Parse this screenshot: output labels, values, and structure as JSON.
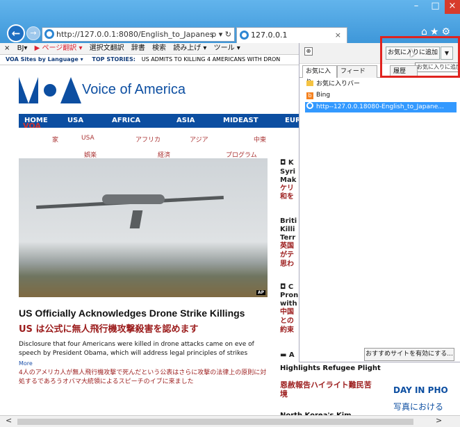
{
  "browser": {
    "address": "http://127.0.0.1:8080/English_to_Japanes",
    "address_host": "127.0.0.1",
    "address_controls": "ρ ▾ ↻",
    "tab_title": "127.0.0.1",
    "tab_close": "×",
    "back_icon": "←",
    "forward_icon": "→",
    "window_minimize": "–",
    "window_maximize": "□",
    "window_close": "×",
    "top_icons": "⌂★⚙"
  },
  "command_bar": {
    "items": [
      "×",
      "BJ▾",
      "▶ ページ翻訳 ▾",
      "選択文翻訳",
      "辞書",
      "検索",
      "読み上げ ▾",
      "ツール ▾"
    ]
  },
  "voa_bar": {
    "brand": "VOA",
    "sites": "Sites by Language ▾",
    "top_label": "TOP STORIES:",
    "headline": "US ADMITS TO KILLING 4 AMERICANS WITH DRON"
  },
  "site": {
    "name": "Voice of America",
    "nav": [
      "HOME",
      "USA",
      "AFRICA",
      "ASIA",
      "MIDEAST",
      "EUR"
    ],
    "nav_overlay": "VOA",
    "subnav_row1": [
      "家",
      "USA",
      "アフリカ",
      "アジア",
      "中東"
    ],
    "subnav_row2": [
      "娯楽",
      "経済",
      "プログラム"
    ]
  },
  "article": {
    "photo_credit": "AP",
    "headline": "US Officially Acknowledges Drone Strike Killings",
    "headline_ja": "US は公式に無人飛行機攻撃殺害を認めます",
    "summary": "Disclosure that four Americans were killed in drone attacks came on eve of speech by President Obama, which will address legal principles of strikes",
    "more": "More",
    "summary_ja": "4人のアメリカ人が無人飛行機攻撃で死んだという公表はさらに攻撃の法律上の原則に対処するであろうオバマ大統領によるスピーチのイブに来ました"
  },
  "sidebar_stories": {
    "s1": [
      "◘ K",
      "Syri",
      "Mak",
      "ケリ",
      "和を"
    ],
    "s2": [
      "Briti",
      "Killi",
      "Terr",
      "英国",
      "がテ",
      "思わ"
    ],
    "s3": [
      "◘ C",
      "Pron",
      "with",
      "中国",
      "との",
      "約束"
    ],
    "s4": "▬ A",
    "highlight": "Highlights Refugee Plight",
    "highlight_ja": "恩赦報告ハイライト難民苦境",
    "north_korea": "North Korea's Kim"
  },
  "day_in_photos": {
    "title": "DAY IN PHO",
    "title_ja": "写真における"
  },
  "favorites": {
    "pin_icon": "⊕",
    "add_button": "お気に入りに追加",
    "add_dropdown": "▼",
    "tooltip": "お気に入りに追加",
    "tabs": [
      "お気に入り",
      "フィード",
      "履歴"
    ],
    "items": [
      "お気に入りバー",
      "Bing",
      "http--127.0.0.18080-English_to_Japane..."
    ],
    "suggest_button": "おすすめサイトを有効にする..."
  },
  "scrollbar": {
    "left": "<",
    "right": ">"
  }
}
